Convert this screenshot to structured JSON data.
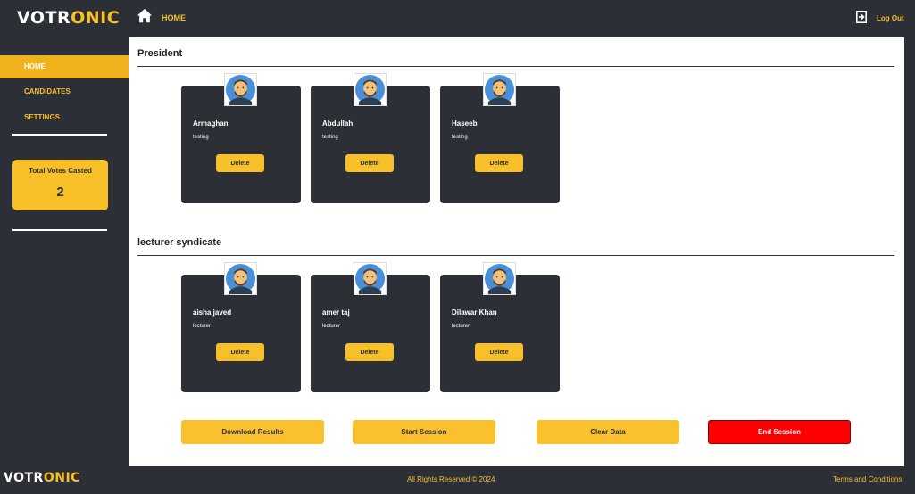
{
  "brand": {
    "logo_white": "VOTR",
    "logo_yellow": "ONIC"
  },
  "header": {
    "page_label": "HOME",
    "logout_label": "Log Out"
  },
  "sidebar": {
    "items": [
      {
        "label": "HOME",
        "active": true
      },
      {
        "label": "CANDIDATES",
        "active": false
      },
      {
        "label": "SETTINGS",
        "active": false
      }
    ],
    "votes_card": {
      "title": "Total Votes Casted",
      "count": "2"
    }
  },
  "sections": [
    {
      "title": "President",
      "candidates": [
        {
          "name": "Armaghan",
          "description": "testing",
          "delete_label": "Delete"
        },
        {
          "name": "Abdullah",
          "description": "testing",
          "delete_label": "Delete"
        },
        {
          "name": "Haseeb",
          "description": "testing",
          "delete_label": "Delete"
        }
      ]
    },
    {
      "title": "lecturer syndicate",
      "candidates": [
        {
          "name": "aisha javed",
          "description": "lecturer",
          "delete_label": "Delete"
        },
        {
          "name": "amer taj",
          "description": "lecturer",
          "delete_label": "Delete"
        },
        {
          "name": "Dilawar Khan",
          "description": "lecturer",
          "delete_label": "Delete"
        }
      ]
    }
  ],
  "actions": {
    "download": "Download Results",
    "start": "Start Session",
    "clear": "Clear Data",
    "end": "End Session"
  },
  "footer": {
    "copyright": "All Rights Reserved © 2024",
    "terms": "Terms and Conditions"
  },
  "colors": {
    "accent": "#f7c028",
    "dark": "#2c2f36",
    "danger": "#ff0000"
  }
}
